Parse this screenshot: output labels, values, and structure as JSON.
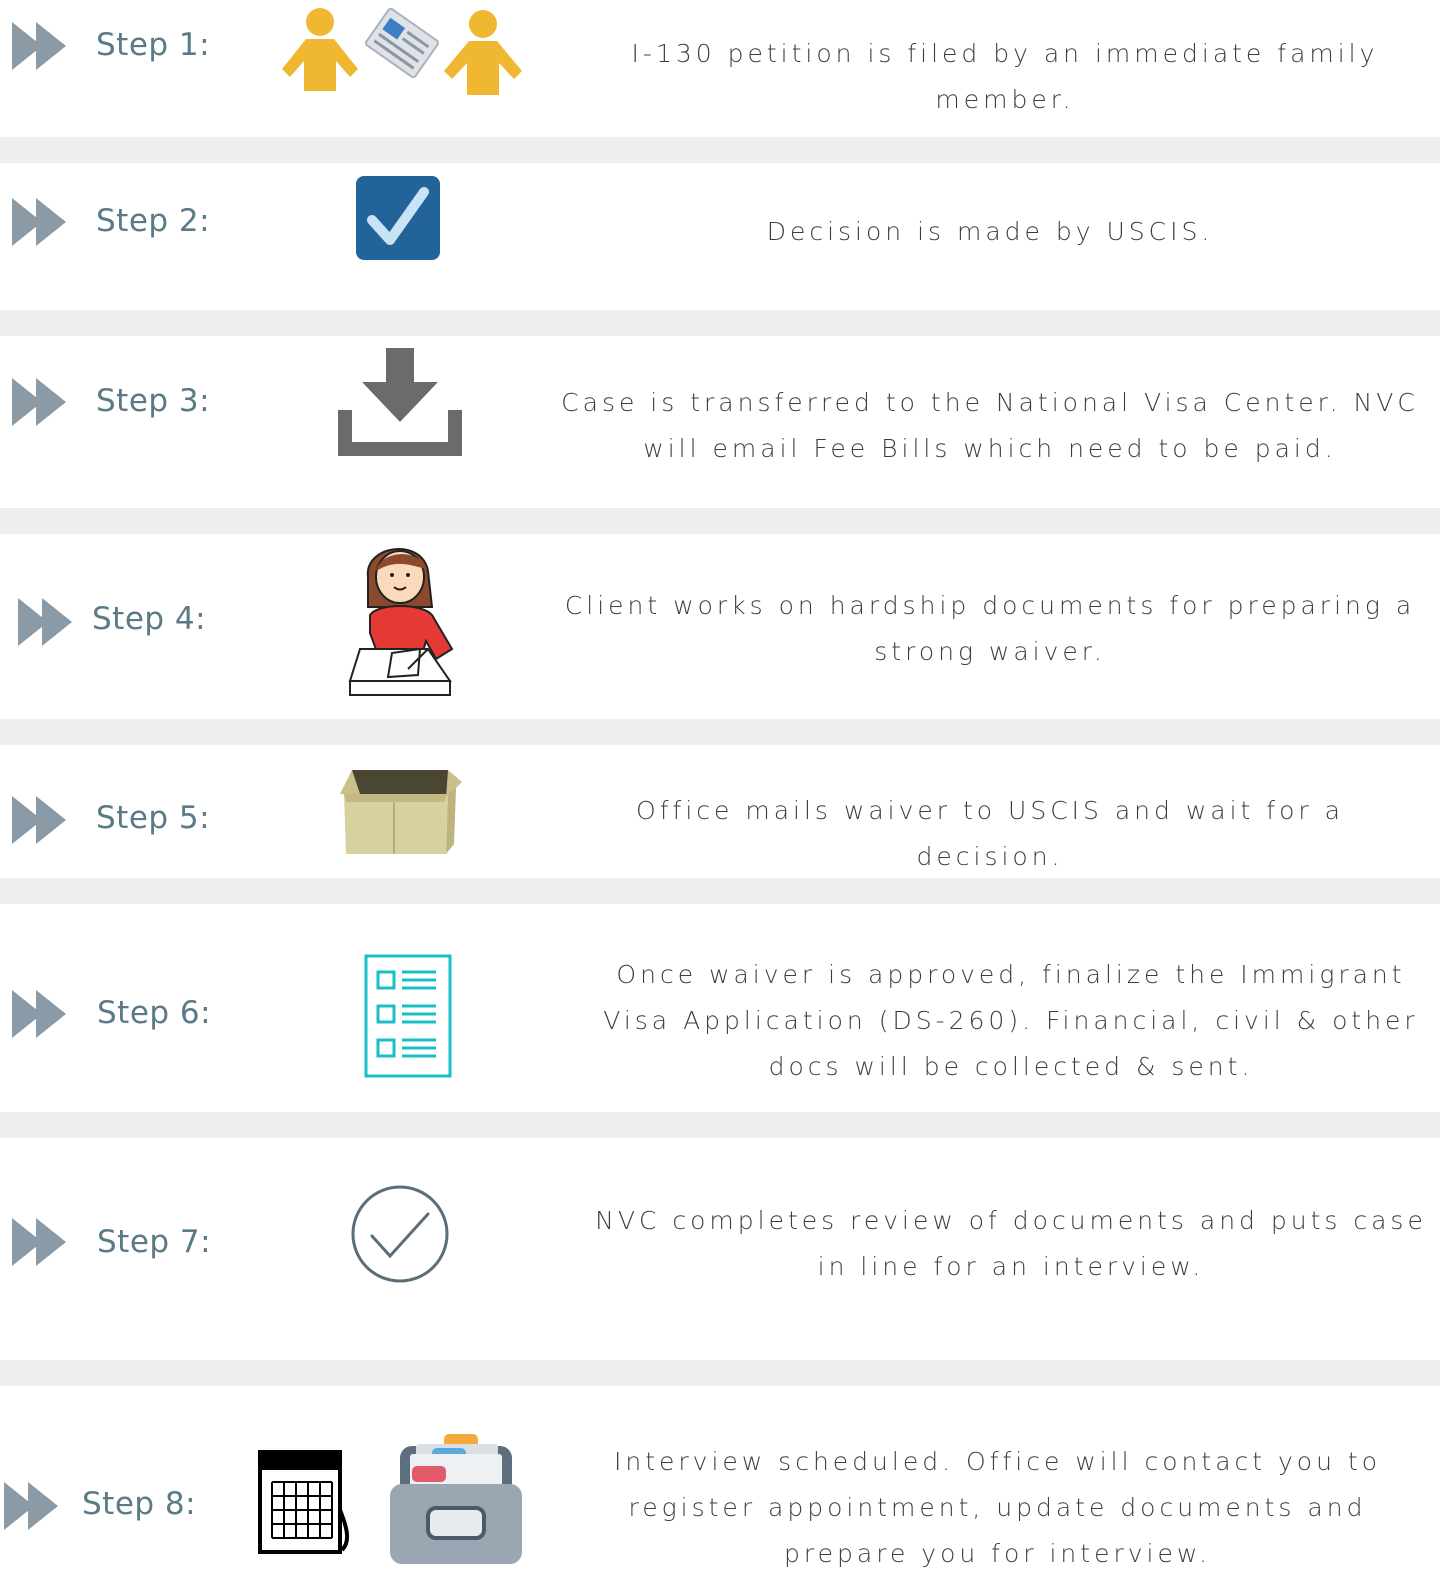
{
  "steps": [
    {
      "label": "Step 1:",
      "icon": "family-petition-icon",
      "description": "I-130 petition is filed by an immediate family member."
    },
    {
      "label": "Step 2:",
      "icon": "checkbox-icon",
      "description": "Decision is made by USCIS."
    },
    {
      "label": "Step 3:",
      "icon": "download-tray-icon",
      "description": "Case is transferred to the National Visa Center. NVC will email Fee Bills which need to be paid."
    },
    {
      "label": "Step 4:",
      "icon": "woman-writing-icon",
      "description": "Client works on hardship documents for preparing a strong waiver."
    },
    {
      "label": "Step 5:",
      "icon": "open-box-icon",
      "description": "Office mails waiver to USCIS and wait for a decision."
    },
    {
      "label": "Step 6:",
      "icon": "checklist-document-icon",
      "description": "Once waiver is approved, finalize the Immigrant Visa Application (DS-260). Financial, civil & other docs will be collected & sent."
    },
    {
      "label": "Step 7:",
      "icon": "circle-check-icon",
      "description": "NVC completes review of documents and puts case in line for an interview."
    },
    {
      "label": "Step 8:",
      "icon": "calendar-file-box-icon",
      "description": "Interview scheduled. Office will contact you to register appointment, update documents and prepare you for interview."
    }
  ],
  "colors": {
    "arrow": "#8a9aa6",
    "step_label": "#5b7a87",
    "description": "#3d3d3d",
    "divider": "#eceef0",
    "person": "#f0b731",
    "checkbox": "#22649a",
    "download": "#6b6b6b",
    "box": "#d9d0a0",
    "document": "#18bfc6",
    "circle_check": "#5a6e7a"
  }
}
